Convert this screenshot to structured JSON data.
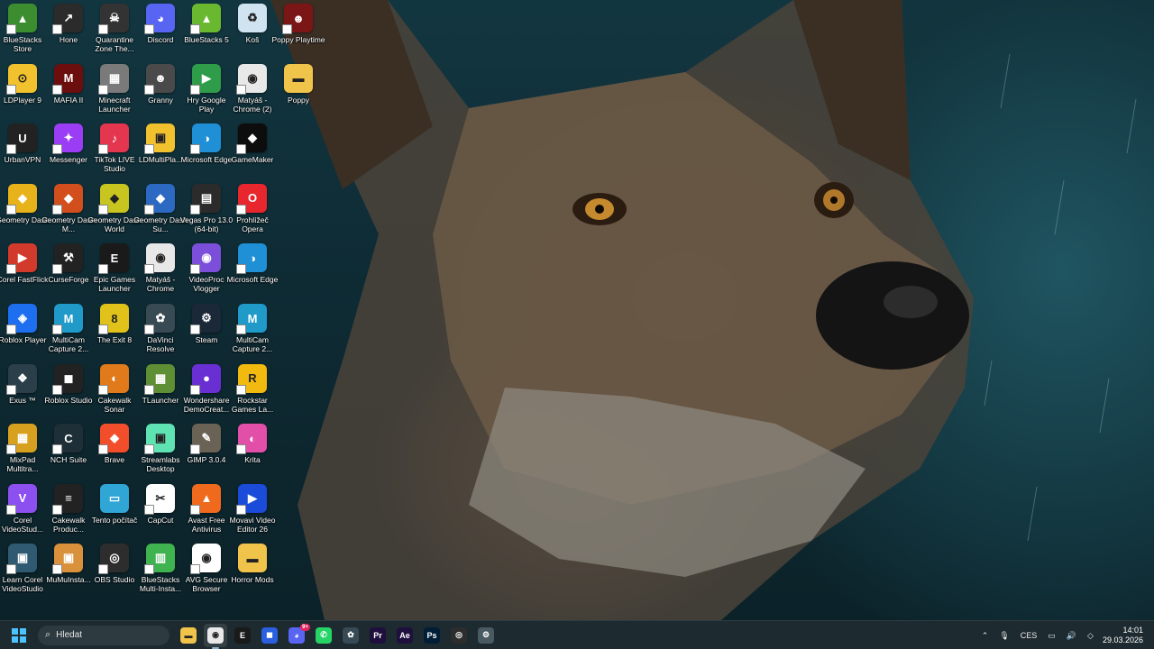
{
  "wallpaper": {
    "subject": "wolf-portrait"
  },
  "desktop_icons": [
    {
      "label": "BlueStacks Store",
      "color": "#3b8d2f",
      "glyph": "▲"
    },
    {
      "label": "LDPlayer 9",
      "color": "#f2c12e",
      "glyph": "⊙"
    },
    {
      "label": "UrbanVPN",
      "color": "#222222",
      "glyph": "U"
    },
    {
      "label": "Geometry Dash",
      "color": "#e8b21b",
      "glyph": "◆"
    },
    {
      "label": "Corel FastFlick",
      "color": "#d23b2b",
      "glyph": "▶"
    },
    {
      "label": "Roblox Player",
      "color": "#1e6ef0",
      "glyph": "◈"
    },
    {
      "label": "Exus ™",
      "color": "#2a3f4a",
      "glyph": "❖"
    },
    {
      "label": "MixPad Multitra...",
      "color": "#d7a11f",
      "glyph": "▦"
    },
    {
      "label": "Corel VideoStud...",
      "color": "#8c4ff0",
      "glyph": "V"
    },
    {
      "label": "Learn Corel VideoStudio",
      "color": "#2f5a72",
      "glyph": "▣"
    },
    {
      "label": "Hone",
      "color": "#2b2b2b",
      "glyph": "↗"
    },
    {
      "label": "MAFIA II",
      "color": "#6d0e0e",
      "glyph": "M"
    },
    {
      "label": "Messenger",
      "color": "#9b3df5",
      "glyph": "✦"
    },
    {
      "label": "Geometry Dash M...",
      "color": "#d24f1d",
      "glyph": "◆"
    },
    {
      "label": "CurseForge",
      "color": "#222222",
      "glyph": "⚒"
    },
    {
      "label": "MultiCam Capture 2...",
      "color": "#1f9ac9",
      "glyph": "M"
    },
    {
      "label": "Roblox Studio",
      "color": "#222222",
      "glyph": "◼"
    },
    {
      "label": "NCH Suite",
      "color": "#1e2f37",
      "glyph": "C"
    },
    {
      "label": "Cakewalk Produc...",
      "color": "#222222",
      "glyph": "≡"
    },
    {
      "label": "MuMuInsta...",
      "color": "#d9913b",
      "glyph": "▣"
    },
    {
      "label": "Quarantine Zone The...",
      "color": "#333333",
      "glyph": "☠"
    },
    {
      "label": "Minecraft Launcher",
      "color": "#7a7a7a",
      "glyph": "▦"
    },
    {
      "label": "TikTok LIVE Studio",
      "color": "#e4364f",
      "glyph": "♪"
    },
    {
      "label": "Geometry Dash World",
      "color": "#c8c420",
      "glyph": "◆"
    },
    {
      "label": "Epic Games Launcher",
      "color": "#1a1a1a",
      "glyph": "E"
    },
    {
      "label": "The Exit 8",
      "color": "#e0c21b",
      "glyph": "8"
    },
    {
      "label": "Cakewalk Sonar",
      "color": "#e07a1b",
      "glyph": "◐"
    },
    {
      "label": "Brave",
      "color": "#f24e2b",
      "glyph": "◆"
    },
    {
      "label": "Tento počítač",
      "color": "#2fa6d6",
      "glyph": "▭"
    },
    {
      "label": "OBS Studio",
      "color": "#2d2d2d",
      "glyph": "◎"
    },
    {
      "label": "Discord",
      "color": "#5865f2",
      "glyph": "◕"
    },
    {
      "label": "Granny",
      "color": "#4a4a4a",
      "glyph": "☻"
    },
    {
      "label": "LDMultiPla...",
      "color": "#f2c12e",
      "glyph": "▣"
    },
    {
      "label": "Geometry Dash Su...",
      "color": "#2c69c2",
      "glyph": "◆"
    },
    {
      "label": "Matyáš - Chrome",
      "color": "#e8e8e8",
      "glyph": "◉"
    },
    {
      "label": "DaVinci Resolve",
      "color": "#384a54",
      "glyph": "✿"
    },
    {
      "label": "TLauncher",
      "color": "#5f8f34",
      "glyph": "▦"
    },
    {
      "label": "Streamlabs Desktop",
      "color": "#60e3b3",
      "glyph": "▣"
    },
    {
      "label": "CapCut",
      "color": "#ffffff",
      "glyph": "✂"
    },
    {
      "label": "BlueStacks Multi-Insta...",
      "color": "#3fb34f",
      "glyph": "▥"
    },
    {
      "label": "BlueStacks 5",
      "color": "#6ab82f",
      "glyph": "▲"
    },
    {
      "label": "Hry Google Play",
      "color": "#2f9c4a",
      "glyph": "▶"
    },
    {
      "label": "Microsoft Edge",
      "color": "#1f8fd6",
      "glyph": "◑"
    },
    {
      "label": "Vegas Pro 13.0 (64-bit)",
      "color": "#2b2b2b",
      "glyph": "▤"
    },
    {
      "label": "VideoProc Vlogger",
      "color": "#7b4fd9",
      "glyph": "◉"
    },
    {
      "label": "Steam",
      "color": "#1b2838",
      "glyph": "⚙"
    },
    {
      "label": "Wondershare DemoCreat...",
      "color": "#6a2fd2",
      "glyph": "●"
    },
    {
      "label": "GIMP 3.0.4",
      "color": "#6b6256",
      "glyph": "✎"
    },
    {
      "label": "Avast Free Antivirus",
      "color": "#f06a1e",
      "glyph": "▲"
    },
    {
      "label": "AVG Secure Browser",
      "color": "#ffffff",
      "glyph": "◉"
    },
    {
      "label": "Koš",
      "color": "#cfe4f0",
      "glyph": "♻"
    },
    {
      "label": "Matyáš - Chrome (2)",
      "color": "#e8e8e8",
      "glyph": "◉"
    },
    {
      "label": "GameMaker",
      "color": "#0d0d0d",
      "glyph": "◆"
    },
    {
      "label": "Prohlížeč Opera",
      "color": "#e8262d",
      "glyph": "O"
    },
    {
      "label": "Microsoft Edge",
      "color": "#1f8fd6",
      "glyph": "◑"
    },
    {
      "label": "MultiCam Capture 2...",
      "color": "#1f9ac9",
      "glyph": "M"
    },
    {
      "label": "Rockstar Games La...",
      "color": "#f2b90f",
      "glyph": "R"
    },
    {
      "label": "Krita",
      "color": "#e24fa8",
      "glyph": "◐"
    },
    {
      "label": "Movavi Video Editor 26",
      "color": "#1a4bd9",
      "glyph": "▶"
    },
    {
      "label": "Horror Mods",
      "color": "#f0c34a",
      "glyph": "▬"
    },
    {
      "label": "Poppy Playtime",
      "color": "#7a1616",
      "glyph": "☻"
    },
    {
      "label": "Poppy",
      "color": "#f0c34a",
      "glyph": "▬"
    }
  ],
  "taskbar": {
    "search_placeholder": "Hledat",
    "pinned": [
      {
        "name": "file-explorer",
        "color": "#f0c34a",
        "glyph": "▬"
      },
      {
        "name": "chrome",
        "color": "#e8e8e8",
        "glyph": "◉"
      },
      {
        "name": "epic-games",
        "color": "#1a1a1a",
        "glyph": "E"
      },
      {
        "name": "app-blue",
        "color": "#2a5fe0",
        "glyph": "◼"
      },
      {
        "name": "discord",
        "color": "#5865f2",
        "glyph": "◕"
      },
      {
        "name": "whatsapp",
        "color": "#25d366",
        "glyph": "✆"
      },
      {
        "name": "davinci",
        "color": "#384a54",
        "glyph": "✿"
      },
      {
        "name": "premiere",
        "color": "#1f0f3d",
        "glyph": "Pr"
      },
      {
        "name": "after-effects",
        "color": "#1f0f3d",
        "glyph": "Ae"
      },
      {
        "name": "photoshop",
        "color": "#001e36",
        "glyph": "Ps"
      },
      {
        "name": "obs",
        "color": "#2d2d2d",
        "glyph": "◎"
      },
      {
        "name": "settings",
        "color": "#4a5a62",
        "glyph": "⚙"
      }
    ],
    "discord_badge": "9+",
    "language": "CES",
    "time": "14:01",
    "date": "29.03.2026"
  }
}
